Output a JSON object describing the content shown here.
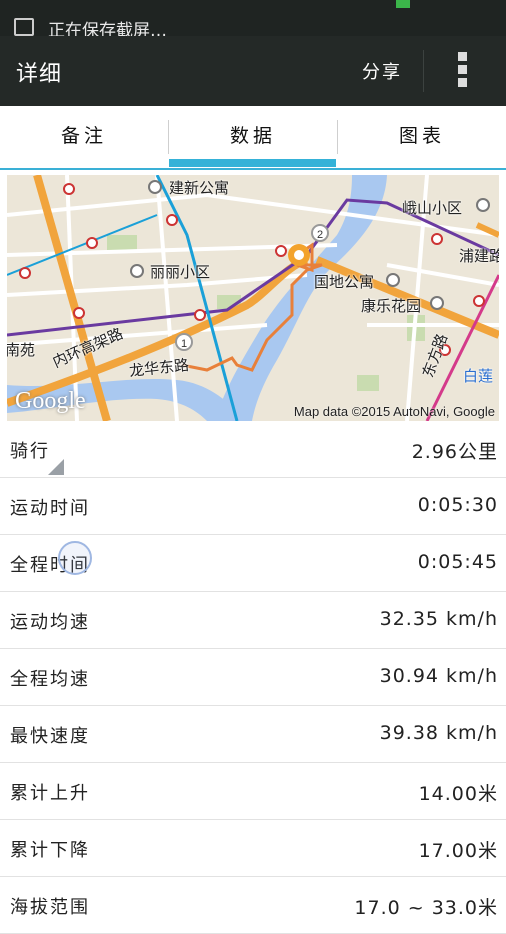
{
  "statusbar": {
    "notification_text": "正在保存截屏…"
  },
  "appbar": {
    "title": "详细",
    "share_label": "分享"
  },
  "tabs": [
    {
      "label": "备注"
    },
    {
      "label": "数据"
    },
    {
      "label": "图表"
    }
  ],
  "map": {
    "labels": {
      "jianxin": "建新公寓",
      "eshan": "峨山小区",
      "lili": "丽丽小区",
      "guodi": "国地公寓",
      "kangle": "康乐花园",
      "pujian": "浦建路",
      "neihuan": "内环高架路",
      "longhua": "龙华东路",
      "dongfang": "东方路",
      "baolian": "白莲",
      "nanyuan": "南苑",
      "marker1": "1",
      "marker2": "2"
    },
    "attribution": "Map data ©2015 AutoNavi, Google",
    "logo": "Google"
  },
  "stats": [
    {
      "label": "骑行",
      "value": "2.96公里"
    },
    {
      "label": "运动时间",
      "value": "0:05:30"
    },
    {
      "label": "全程时间",
      "value": "0:05:45"
    },
    {
      "label": "运动均速",
      "value": "32.35 km/h"
    },
    {
      "label": "全程均速",
      "value": "30.94 km/h"
    },
    {
      "label": "最快速度",
      "value": "39.38 km/h"
    },
    {
      "label": "累计上升",
      "value": "14.00米"
    },
    {
      "label": "累计下降",
      "value": "17.00米"
    },
    {
      "label": "海拔范围",
      "value": "17.0 ~ 33.0米"
    }
  ]
}
